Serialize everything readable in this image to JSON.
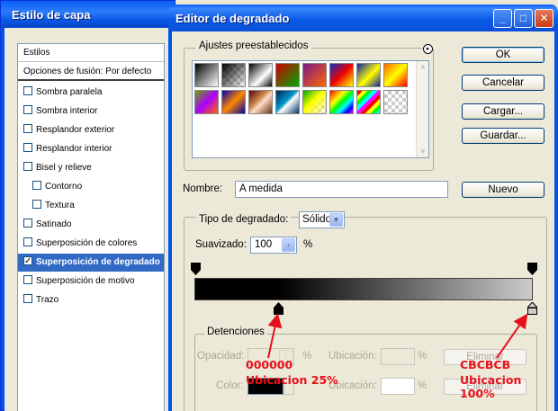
{
  "layer_style_window": {
    "title": "Estilo de capa",
    "list": {
      "header": "Estilos",
      "blending": "Opciones de fusión: Por defecto",
      "items": [
        {
          "label": "Sombra paralela",
          "checked": false
        },
        {
          "label": "Sombra interior",
          "checked": false
        },
        {
          "label": "Resplandor exterior",
          "checked": false
        },
        {
          "label": "Resplandor interior",
          "checked": false
        },
        {
          "label": "Bisel y relieve",
          "checked": false
        },
        {
          "label": "Contorno",
          "checked": false,
          "indent": true
        },
        {
          "label": "Textura",
          "checked": false,
          "indent": true
        },
        {
          "label": "Satinado",
          "checked": false
        },
        {
          "label": "Superposición de colores",
          "checked": false
        },
        {
          "label": "Superposición de degradado",
          "checked": true,
          "active": true
        },
        {
          "label": "Superposición de motivo",
          "checked": false
        },
        {
          "label": "Trazo",
          "checked": false
        }
      ]
    }
  },
  "gradient_editor": {
    "title": "Editor de degradado",
    "title_buttons": {
      "minimize": "_",
      "maximize": "□",
      "close": "✕"
    },
    "presets": {
      "label": "Ajustes preestablecidos",
      "menu_icon": "▸"
    },
    "buttons": {
      "ok": "OK",
      "cancel": "Cancelar",
      "load": "Cargar...",
      "save": "Guardar...",
      "new": "Nuevo"
    },
    "name": {
      "label": "Nombre:",
      "value": "A medida"
    },
    "type": {
      "label": "Tipo de degradado:",
      "value": "Sólido"
    },
    "smoothness": {
      "label": "Suavizado:",
      "value": "100",
      "unit": "%"
    },
    "gradient": {
      "colors": [
        "#000000",
        "#cbcbcb"
      ],
      "black_stop_location": 25,
      "gray_stop_location": 100
    },
    "stops": {
      "label": "Detenciones",
      "opacity_label": "Opacidad:",
      "opacity_unit": "%",
      "location_label": "Ubicación:",
      "location_unit": "%",
      "color_label": "Color:",
      "delete_label": "Eliminar"
    }
  },
  "annotations": {
    "left_hex": "000000",
    "left_location": "Ubicacion 25%",
    "right_hex": "CBCBCB",
    "right_location": "Ubicacion 100%",
    "color": "#e8101a"
  }
}
